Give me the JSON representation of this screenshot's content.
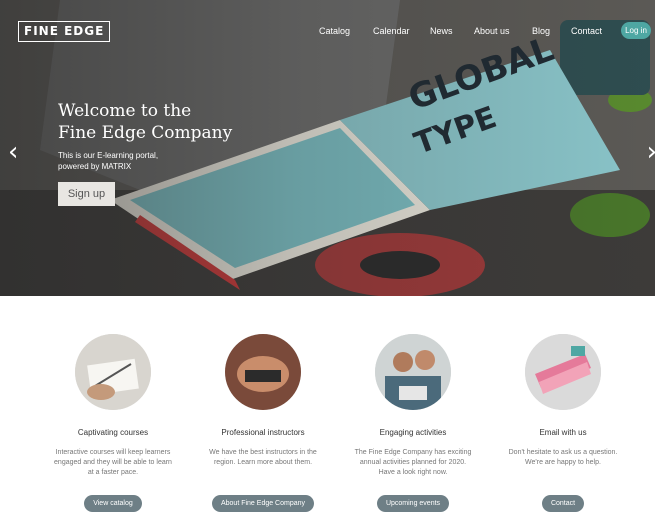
{
  "brand": {
    "logo_text": "FINE EDGE"
  },
  "nav": {
    "items": [
      {
        "label": "Catalog"
      },
      {
        "label": "Calendar"
      },
      {
        "label": "News"
      },
      {
        "label": "About us"
      },
      {
        "label": "Blog"
      },
      {
        "label": "Contact"
      }
    ],
    "login_label": "Log in"
  },
  "hero": {
    "title_line1": "Welcome to the",
    "title_line2": "Fine Edge Company",
    "subtitle_line1": "This is our E-learning portal,",
    "subtitle_line2": "powered by MATRIX",
    "signup_label": "Sign up",
    "prev_arrow": "‹",
    "next_arrow": "›"
  },
  "features": [
    {
      "title": "Captivating courses",
      "text": "Interactive courses will keep learners engaged and they will be able to learn at a faster pace.",
      "button": "View catalog",
      "icon": "pencil-sketch-icon"
    },
    {
      "title": "Professional instructors",
      "text": "We have the best instructors in the region. Learn more about them.",
      "button": "About Fine Edge Company",
      "icon": "handshake-icon"
    },
    {
      "title": "Engaging activities",
      "text": "The Fine Edge Company has exciting annual activities planned for 2020. Have a look right now.",
      "button": "Upcoming events",
      "icon": "team-laptop-icon"
    },
    {
      "title": "Email with us",
      "text": "Don't hesitate to ask us a question. We're are happy to help.",
      "button": "Contact",
      "icon": "swatches-icon"
    }
  ],
  "colors": {
    "accent": "#4ea7a3",
    "button": "#6e7f86"
  }
}
